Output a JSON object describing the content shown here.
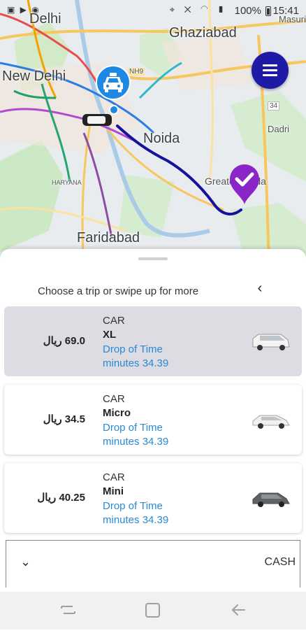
{
  "status_bar": {
    "battery": "100%",
    "time": "15:41"
  },
  "map": {
    "cities": {
      "delhi": "Delhi",
      "ghaziabad": "Ghaziabad",
      "new_delhi": "New Delhi",
      "noida": "Noida",
      "greater_noida": "Greater Noida",
      "faridabad": "Faridabad",
      "masuri": "Masuri",
      "dadri": "Dadri",
      "nh9": "NH9",
      "route_34": "34",
      "haryana": "HARYANA"
    }
  },
  "sheet": {
    "prompt": "Choose a trip or swipe up for more",
    "rides": [
      {
        "category": "CAR",
        "name": "XL",
        "price": "69.0 ريال",
        "drop_label": "Drop of Time",
        "minutes_label": "minutes 34.39",
        "selected": true
      },
      {
        "category": "CAR",
        "name": "Micro",
        "price": "34.5 ريال",
        "drop_label": "Drop of Time",
        "minutes_label": "minutes 34.39",
        "selected": false
      },
      {
        "category": "CAR",
        "name": "Mini",
        "price": "40.25 ريال",
        "drop_label": "Drop of Time",
        "minutes_label": "minutes 34.39",
        "selected": false
      }
    ],
    "payment_method": "CASH"
  },
  "colors": {
    "accent_blue": "#1f1aa6",
    "route": "#15129c",
    "pickup_pin": "#1e88e5",
    "drop_pin": "#8a26c7",
    "link_blue": "#2a8ad4"
  }
}
